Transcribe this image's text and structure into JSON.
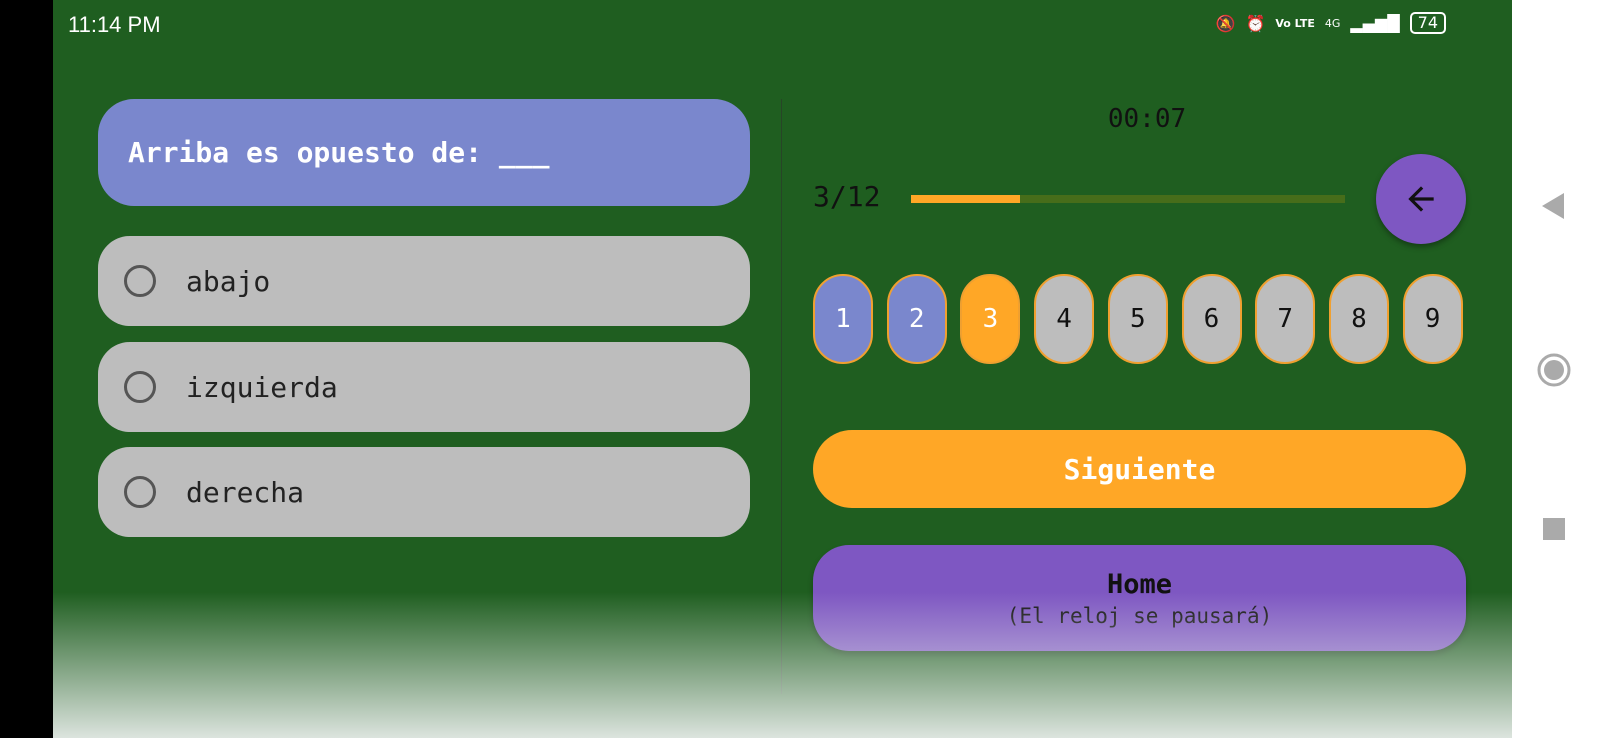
{
  "status_bar": {
    "time": "11:14 PM",
    "network": "4G",
    "volte": "Vo LTE",
    "battery": "74"
  },
  "question": {
    "text": "Arriba es opuesto de: ___"
  },
  "options": [
    {
      "label": "abajo"
    },
    {
      "label": "izquierda"
    },
    {
      "label": "derecha"
    }
  ],
  "timer": "00:07",
  "progress": {
    "label": "3/12",
    "current": 3,
    "total": 12
  },
  "question_numbers": [
    {
      "n": "1",
      "state": "answered"
    },
    {
      "n": "2",
      "state": "answered"
    },
    {
      "n": "3",
      "state": "current"
    },
    {
      "n": "4",
      "state": "pending"
    },
    {
      "n": "5",
      "state": "pending"
    },
    {
      "n": "6",
      "state": "pending"
    },
    {
      "n": "7",
      "state": "pending"
    },
    {
      "n": "8",
      "state": "pending"
    },
    {
      "n": "9",
      "state": "pending"
    }
  ],
  "buttons": {
    "next": "Siguiente",
    "home_title": "Home",
    "home_subtitle": "(El reloj se pausará)"
  },
  "colors": {
    "background": "#1f5e20",
    "answered": "#7a87cd",
    "current": "#ffa726",
    "pending": "#bdbdbd",
    "accent_purple": "#7e57c2"
  },
  "icons": [
    "back-arrow-icon",
    "radio-unchecked-icon",
    "nav-back-icon",
    "nav-home-icon",
    "nav-recents-icon"
  ]
}
